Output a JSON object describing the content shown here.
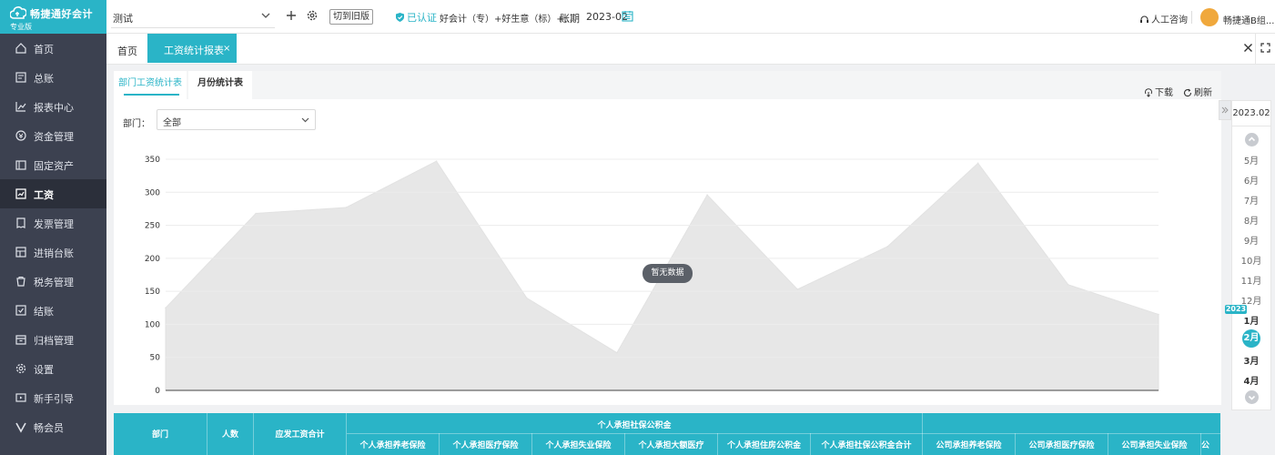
{
  "brand": {
    "name": "畅捷通好会计",
    "edition": "专业版",
    "accent": "#2ab4c7"
  },
  "topbar": {
    "account": "测试",
    "switch_old": "切到旧版",
    "verified": "已认证",
    "plan": "好会计（专）+好生意（标）+...",
    "period_label": "账期",
    "period_value": "2023-02",
    "service": "人工咨询",
    "user": "畅捷通B组..."
  },
  "sidebar": {
    "items": [
      {
        "label": "首页",
        "icon": "home-icon"
      },
      {
        "label": "总账",
        "icon": "ledger-icon"
      },
      {
        "label": "报表中心",
        "icon": "chart-icon"
      },
      {
        "label": "资金管理",
        "icon": "money-icon"
      },
      {
        "label": "固定资产",
        "icon": "asset-icon"
      },
      {
        "label": "工资",
        "icon": "salary-icon"
      },
      {
        "label": "发票管理",
        "icon": "invoice-icon"
      },
      {
        "label": "进销台账",
        "icon": "stock-icon"
      },
      {
        "label": "税务管理",
        "icon": "tax-icon"
      },
      {
        "label": "结账",
        "icon": "close-books-icon"
      },
      {
        "label": "归档管理",
        "icon": "archive-icon"
      },
      {
        "label": "设置",
        "icon": "gear-icon"
      },
      {
        "label": "新手引导",
        "icon": "guide-icon"
      },
      {
        "label": "畅会员",
        "icon": "vip-icon"
      }
    ],
    "active_index": 5
  },
  "tabs": {
    "home": "首页",
    "active": "工资统计报表",
    "close": "×"
  },
  "subtabs": {
    "dept": "部门工资统计表",
    "month": "月份统计表"
  },
  "actions": {
    "download": "下载",
    "refresh": "刷新"
  },
  "filter": {
    "label": "部门：",
    "value": "全部"
  },
  "chart_data": {
    "type": "area",
    "note": "暂无数据",
    "y_ticks": [
      "0",
      "50",
      "100",
      "150",
      "200",
      "250",
      "300",
      "350"
    ],
    "ylim": [
      0,
      350
    ],
    "values": [
      125,
      268,
      277,
      347,
      140,
      57,
      296,
      153,
      218,
      344,
      160,
      115
    ],
    "grid": true,
    "fill_color": "#e7e7e7"
  },
  "table": {
    "headers": {
      "dept": "部门",
      "count": "人数",
      "gross": "应发工资合计",
      "group_personal": "个人承担社保公积金",
      "cols": [
        "个人承担养老保险",
        "个人承担医疗保险",
        "个人承担失业保险",
        "个人承担大额医疗",
        "个人承担住房公积金",
        "个人承担社保公积金合计",
        "公司承担养老保险",
        "公司承担医疗保险",
        "公司承担失业保险",
        "公"
      ]
    }
  },
  "period_rail": {
    "current": "2023.02",
    "months": [
      "5月",
      "6月",
      "7月",
      "8月",
      "9月",
      "10月",
      "11月",
      "12月",
      "1月",
      "2月",
      "3月",
      "4月"
    ],
    "year_badge": "2023",
    "selected_index": 9
  }
}
